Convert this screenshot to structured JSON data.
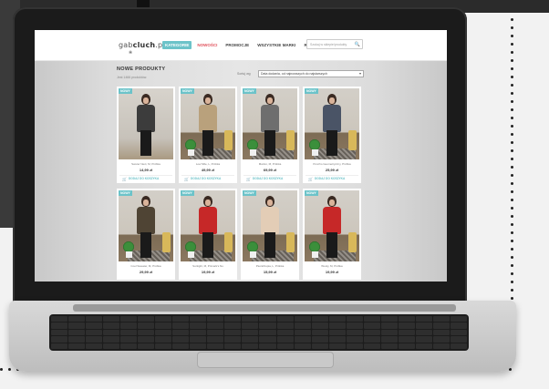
{
  "site": {
    "logo_main": "gab",
    "logo_bold": "cluch",
    "logo_suffix": ".pl",
    "logo_mark": "❀"
  },
  "nav": {
    "items": [
      {
        "label": "KATEGORIE",
        "state": "active"
      },
      {
        "label": "NOWOŚCI",
        "state": "sale"
      },
      {
        "label": "PROMOCJE",
        "state": "normal"
      },
      {
        "label": "WSZYSTKIE MARKI",
        "state": "normal"
      },
      {
        "label": "ROZMIARY",
        "state": "normal"
      }
    ],
    "search_placeholder": "Szukaj w sklepie/produkty"
  },
  "listing": {
    "title": "NOWE PRODUKTY",
    "count": "Jest 1466 produktów.",
    "sort_label": "Sortuj wg",
    "sort_value": "Data dodania, od najnowszych do najstarszych"
  },
  "products": [
    {
      "badge": "NOWY",
      "name": "Sweter Next, M, Próbka",
      "price": "14,99 zł",
      "cart": "DODAJ DO KOSZYKA",
      "top": "#3c3c3c",
      "scene": "wall"
    },
    {
      "badge": "NOWY",
      "name": "Low Mile, L, Próbka",
      "price": "49,99 zł",
      "cart": "DODAJ DO KOSZYKA",
      "top": "#b9a17c",
      "scene": "floor"
    },
    {
      "badge": "NOWY",
      "name": "Marlon, M, Próbka",
      "price": "69,99 zł",
      "cart": "DODAJ DO KOSZYKA",
      "top": "#6e6e6e",
      "scene": "floor"
    },
    {
      "badge": "NOWY",
      "name": "Poncho Geometryczny, Próbka",
      "price": "25,99 zł",
      "cart": "DODAJ DO KOSZYKA",
      "top": "#4a5466",
      "scene": "floor"
    },
    {
      "badge": "NOWY",
      "name": "Cool Sweater, M, Próbka",
      "price": "29,99 zł",
      "cart": "",
      "top": "#4f4434",
      "scene": "floor"
    },
    {
      "badge": "NOWY",
      "name": "Sunlight, M, Primark's Nu",
      "price": "19,99 zł",
      "cart": "",
      "top": "#c62828",
      "scene": "floor"
    },
    {
      "badge": "NOWY",
      "name": "Pieza/Kopia, L, Próbka",
      "price": "15,99 zł",
      "cart": "",
      "top": "#e3cdb6",
      "scene": "floor"
    },
    {
      "badge": "NOWY",
      "name": "Wooly, M, Próbka",
      "price": "19,99 zł",
      "cart": "",
      "top": "#c62828",
      "scene": "floor"
    }
  ],
  "colors": {
    "accent": "#6cc3c9",
    "sale": "#e0505a"
  }
}
